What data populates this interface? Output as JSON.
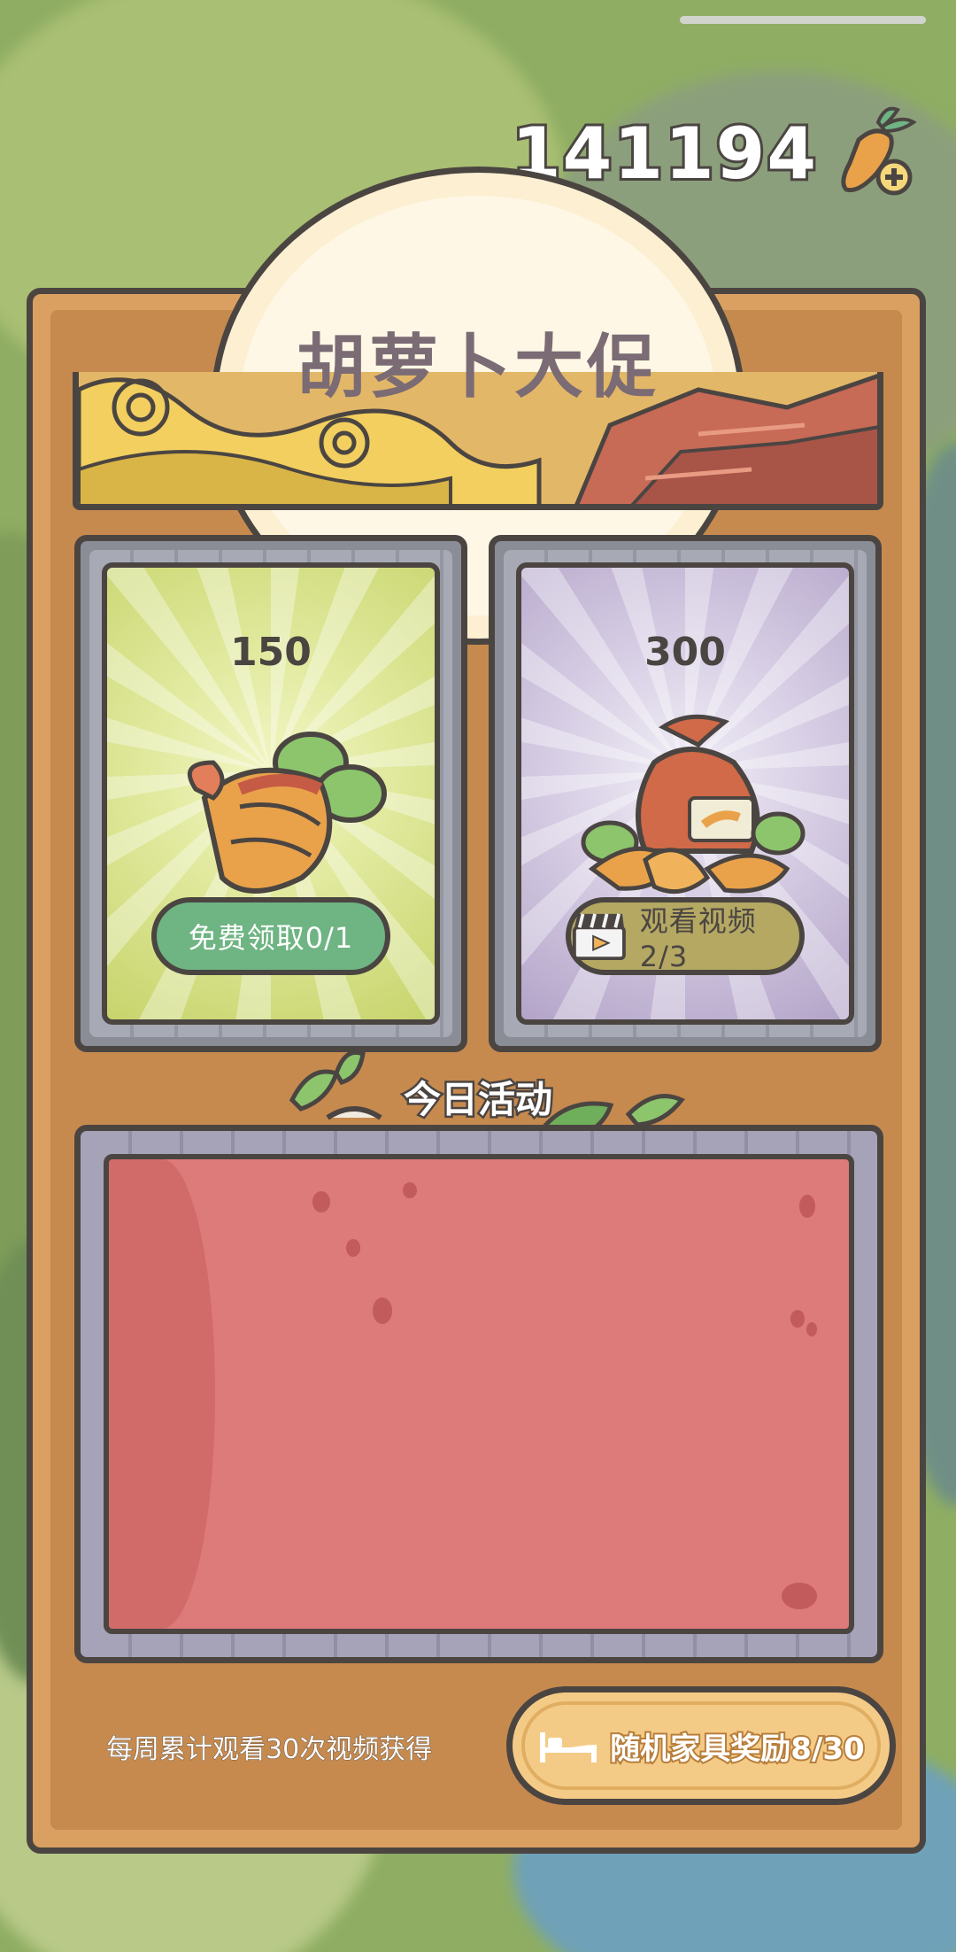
{
  "status_bar": {
    "carrot_count": "141194"
  },
  "promo": {
    "title": "胡萝卜大促"
  },
  "offers": [
    {
      "price": "150",
      "button_label": "免费领取0/1",
      "icon": "carrot-bundle-icon"
    },
    {
      "price": "300",
      "button_label": "观看视频2/3",
      "icon": "carrot-sack-icon",
      "button_icon": "clapperboard-icon"
    }
  ],
  "activity": {
    "title": "今日活动"
  },
  "footer": {
    "weekly_note": "每周累计观看30次视频获得",
    "furniture_button_label": "随机家具奖励8/30",
    "furniture_icon": "bed-icon"
  },
  "colors": {
    "outline": "#4b4542",
    "free_button": "#6fb483",
    "video_button": "#b4a863",
    "activity_panel": "#dd7a7a",
    "furniture_button": "#f4cb86"
  }
}
